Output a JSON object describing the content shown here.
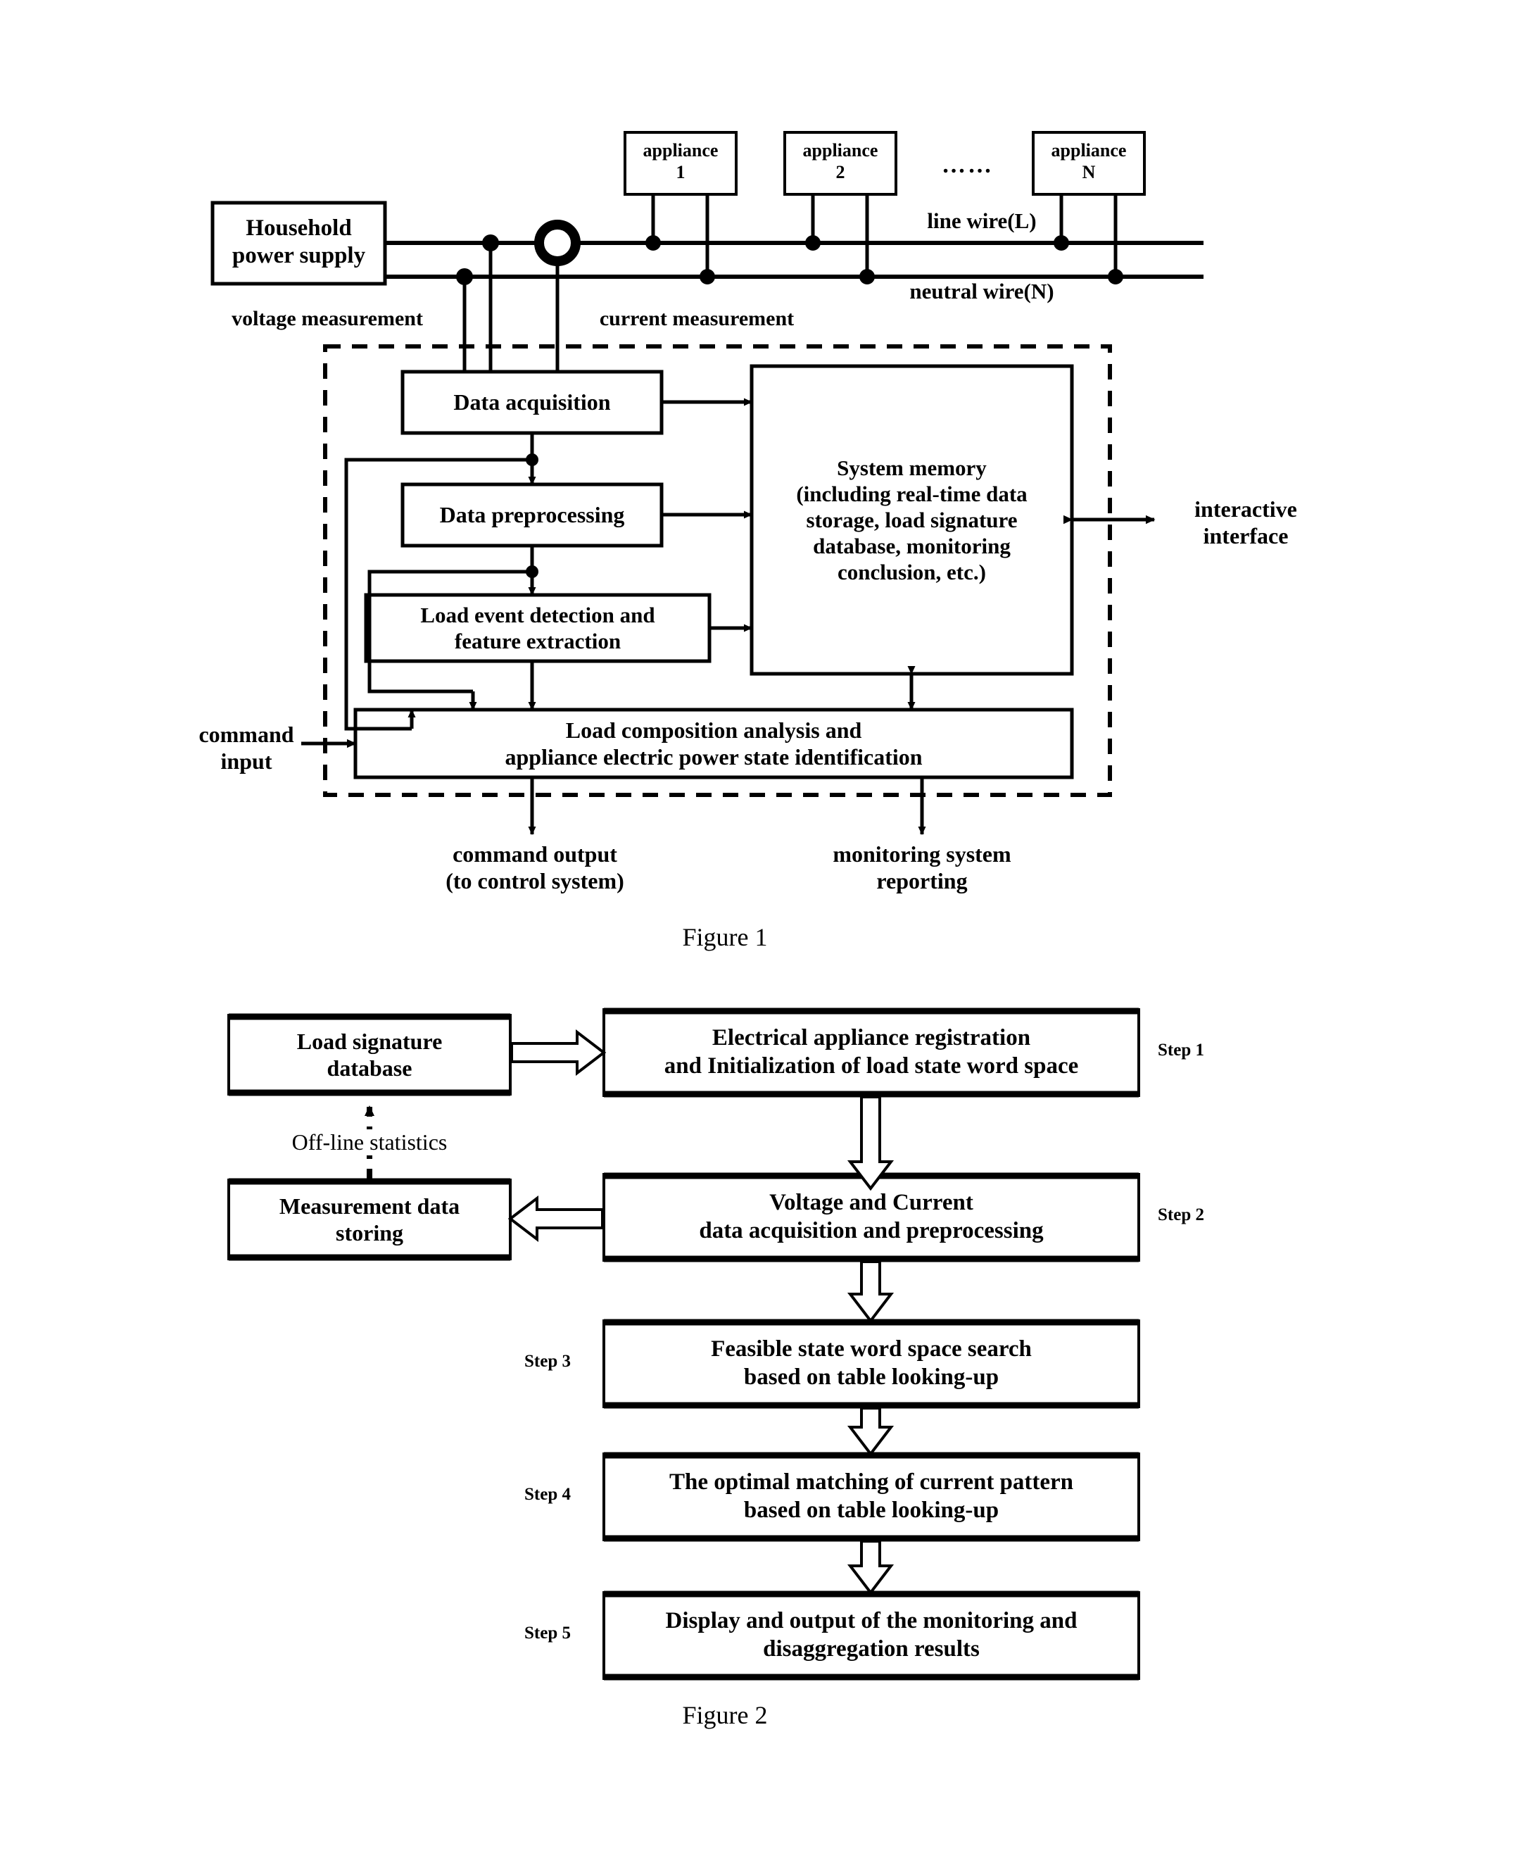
{
  "figure1": {
    "caption": "Figure    1",
    "power_supply": "Household\npower supply",
    "appliances": [
      {
        "label": "appliance\n1"
      },
      {
        "label": "appliance\n2"
      },
      {
        "label": "appliance\nN"
      }
    ],
    "ellipsis": "……",
    "wires": {
      "line": "line wire(L)",
      "neutral": "neutral wire(N)"
    },
    "measurements": {
      "voltage": "voltage measurement",
      "current": "current measurement"
    },
    "blocks": {
      "data_acquisition": "Data acquisition",
      "data_preprocessing": "Data preprocessing",
      "load_event": "Load event detection and\nfeature extraction",
      "system_memory": "System memory\n(including real-time data\nstorage, load signature\ndatabase, monitoring\nconclusion, etc.)",
      "load_composition": "Load composition analysis and\nappliance electric power state identification"
    },
    "external": {
      "interactive_interface": "interactive\ninterface",
      "command_input": "command\ninput",
      "command_output": "command output\n(to control system)",
      "monitoring_report": "monitoring system\nreporting"
    }
  },
  "figure2": {
    "caption": "Figure    2",
    "side_blocks": {
      "load_signature_db": "Load signature\ndatabase",
      "measurement_storing": "Measurement data\nstoring"
    },
    "offline_label": "Off-line statistics",
    "steps": [
      {
        "tag": "Step 1",
        "text": "Electrical appliance registration\nand Initialization of load state word space"
      },
      {
        "tag": "Step 2",
        "text": "Voltage and Current\ndata acquisition and preprocessing"
      },
      {
        "tag": "Step 3",
        "text": "Feasible state word space search\nbased on table looking-up"
      },
      {
        "tag": "Step 4",
        "text": "The optimal matching of current pattern\nbased on table looking-up"
      },
      {
        "tag": "Step 5",
        "text": "Display and output of the monitoring and\ndisaggregation results"
      }
    ]
  },
  "colors": {
    "ink": "#000000",
    "paper": "#ffffff"
  }
}
